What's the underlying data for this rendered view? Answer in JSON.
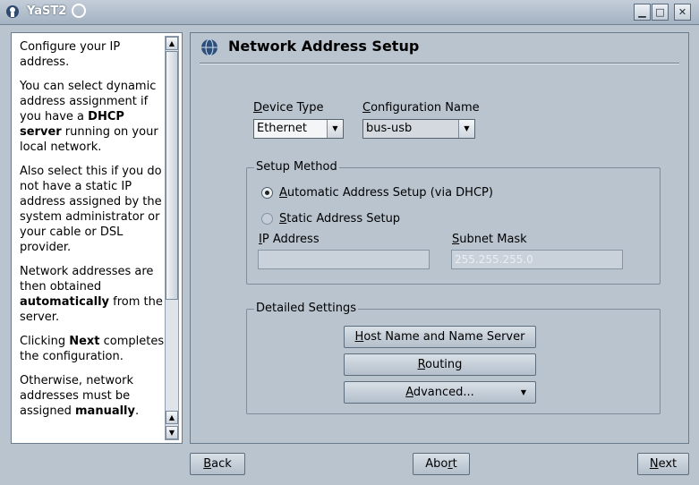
{
  "window": {
    "title": "YaST2",
    "controls": {
      "minimize": "▁",
      "maximize": "□",
      "close": "✕"
    }
  },
  "help": {
    "paragraphs": [
      {
        "parts": [
          {
            "text": "Configure your IP address."
          }
        ]
      },
      {
        "parts": [
          {
            "text": "You can select dynamic address assignment if you have a "
          },
          {
            "text": "DHCP server",
            "bold": true
          },
          {
            "text": " running on your local network."
          }
        ]
      },
      {
        "parts": [
          {
            "text": "Also select this if you do not have a static IP address assigned by the system administrator or your cable or DSL provider."
          }
        ]
      },
      {
        "parts": [
          {
            "text": "Network addresses are then obtained "
          },
          {
            "text": "automatically",
            "bold": true
          },
          {
            "text": " from the server."
          }
        ]
      },
      {
        "parts": [
          {
            "text": "Clicking "
          },
          {
            "text": "Next",
            "bold": true
          },
          {
            "text": " completes the configuration."
          }
        ]
      },
      {
        "parts": [
          {
            "text": "Otherwise, network addresses must be assigned "
          },
          {
            "text": "manually",
            "bold": true
          },
          {
            "text": "."
          }
        ]
      }
    ]
  },
  "main": {
    "title": "Network Address Setup",
    "device_type": {
      "label_hot": "D",
      "label_rest": "evice Type",
      "value": "Ethernet"
    },
    "config_name": {
      "label_hot": "C",
      "label_rest": "onfiguration Name",
      "value": "bus-usb"
    },
    "setup_method": {
      "title": "Setup Method",
      "auto_label": {
        "hot": "A",
        "rest": "utomatic Address Setup (via DHCP)"
      },
      "static_label": {
        "hot": "S",
        "rest": "tatic Address Setup"
      },
      "selected": "automatic",
      "ip": {
        "label_hot": "I",
        "label_rest": "P Address",
        "value": ""
      },
      "mask": {
        "label_hot": "S",
        "label_rest": "ubnet Mask",
        "value": "255.255.255.0"
      }
    },
    "detailed": {
      "title": "Detailed Settings",
      "host_btn": {
        "hot": "H",
        "rest": "ost Name and Name Server"
      },
      "routing_btn": {
        "hot": "R",
        "rest": "outing"
      },
      "advanced_btn": {
        "hot": "A",
        "rest": "dvanced..."
      }
    }
  },
  "footer": {
    "back": {
      "hot": "B",
      "rest": "ack"
    },
    "abort": {
      "pre": "Abo",
      "hot": "r",
      "rest": "t"
    },
    "next": {
      "hot": "N",
      "rest": "ext"
    }
  }
}
